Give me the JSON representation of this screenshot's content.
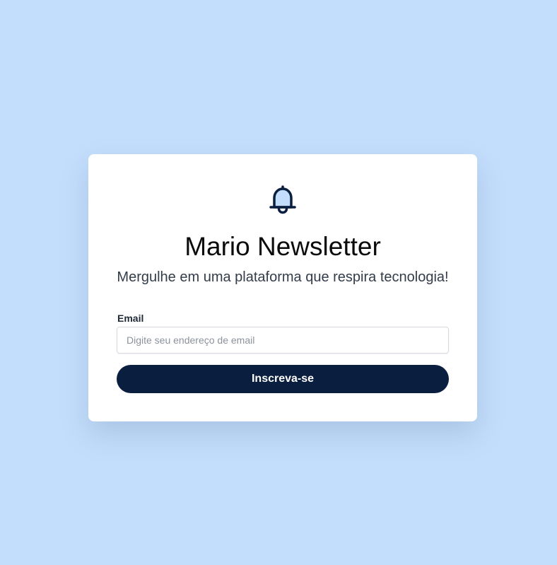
{
  "colors": {
    "page_background": "#c3defc",
    "card_background": "#ffffff",
    "button_background": "#0a1e3f",
    "bell_fill": "#c3defc",
    "bell_stroke": "#0a1e3f"
  },
  "icon": {
    "name": "bell-icon"
  },
  "card": {
    "title": "Mario Newsletter",
    "subtitle": "Mergulhe em uma plataforma que respira tecnologia!",
    "email_label": "Email",
    "email_value": "",
    "email_placeholder": "Digite seu endereço de email",
    "submit_label": "Inscreva-se"
  }
}
